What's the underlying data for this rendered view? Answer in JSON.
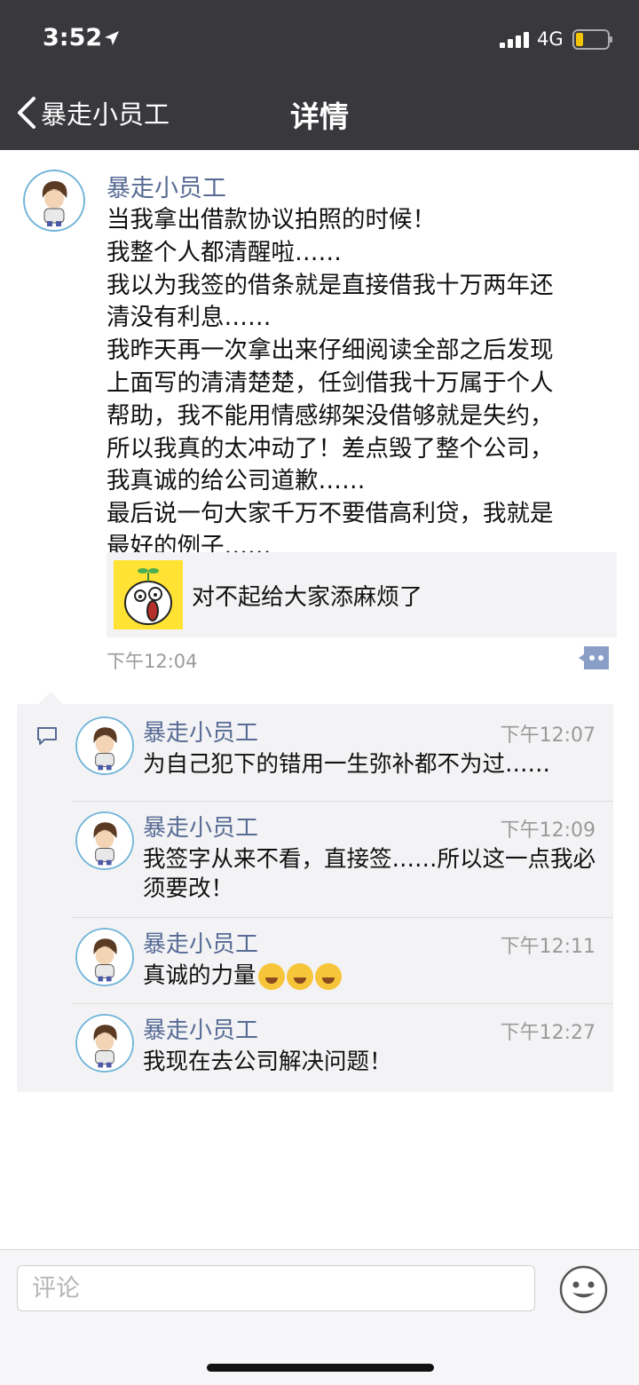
{
  "status_bar": {
    "time": "3:52",
    "network": "4G",
    "battery_color": "#f5c400"
  },
  "nav": {
    "back_label": "暴走小员工",
    "title": "详情"
  },
  "post": {
    "author": "暴走小员工",
    "lines": [
      "当我拿出借款协议拍照的时候！",
      "我整个人都清醒啦……",
      "我以为我签的借条就是直接借我十万两年还",
      "清没有利息……",
      "我昨天再一次拿出来仔细阅读全部之后发现",
      "上面写的清清楚楚，任剑借我十万属于个人",
      "帮助，我不能用情感绑架没借够就是失约，",
      "所以我真的太冲动了！差点毁了整个公司，",
      "我真诚的给公司道歉……",
      "最后说一句大家千万不要借高利贷，我就是",
      "最好的例子……"
    ],
    "shared_title": "对不起给大家添麻烦了",
    "time": "下午12:04"
  },
  "comments": [
    {
      "name": "暴走小员工",
      "time": "下午12:07",
      "text": "为自己犯下的错用一生弥补都不为过……"
    },
    {
      "name": "暴走小员工",
      "time": "下午12:09",
      "text": "我签字从来不看，直接签……所以这一点我必须要改！"
    },
    {
      "name": "暴走小员工",
      "time": "下午12:11",
      "text": "真诚的力量",
      "emoji_count": 3
    },
    {
      "name": "暴走小员工",
      "time": "下午12:27",
      "text": "我现在去公司解决问题！"
    }
  ],
  "bottom": {
    "input_placeholder": "评论"
  },
  "colors": {
    "link_blue": "#576b95",
    "header_bg": "#38383d",
    "comment_bg": "#f3f3f5"
  }
}
